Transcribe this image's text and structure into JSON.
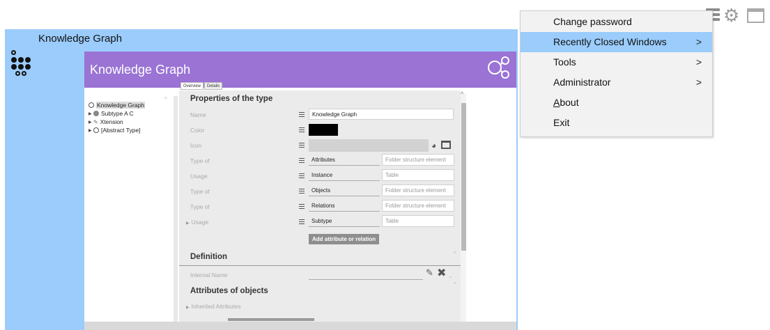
{
  "window": {
    "title": "Knowledge Graph"
  },
  "app": {
    "header_title": "Knowledge Graph",
    "tabs": [
      {
        "label": "Overview"
      },
      {
        "label": "Details"
      }
    ]
  },
  "tree": {
    "items": [
      {
        "label": "Knowledge Graph",
        "icon": "circle-outline-icon",
        "selected": true
      },
      {
        "label": "Subtype A C",
        "icon": "circle-filled-icon"
      },
      {
        "label": "Xtension",
        "icon": "pen-icon"
      },
      {
        "label": "[Abstract Type]",
        "icon": "circle-outline-icon"
      }
    ]
  },
  "properties": {
    "section_title": "Properties of the type",
    "name_label": "Name",
    "name_value": "Knowledge Graph",
    "color_label": "Color",
    "color_value": "#000000",
    "icon_label": "Icon",
    "rows": [
      {
        "label": "Type of",
        "value": "Attributes",
        "extra": "Folder structure element"
      },
      {
        "label": "Usage",
        "value": "Instance",
        "extra": "Table"
      },
      {
        "label": "Type of",
        "value": "Objects",
        "extra": "Folder structure element"
      },
      {
        "label": "Type of",
        "value": "Relations",
        "extra": "Folder structure element"
      },
      {
        "label": "Usage",
        "value": "Subtype",
        "extra": "Table"
      }
    ],
    "add_button": "Add attribute or relation"
  },
  "definition": {
    "section_title": "Definition",
    "internal_name_label": "Internal Name"
  },
  "attributes": {
    "section_title": "Attributes of objects",
    "inherited_label": "Inherited Attributes"
  },
  "menu": {
    "items": [
      {
        "label": "Change password",
        "submenu": false
      },
      {
        "label": "Recently Closed Windows",
        "submenu": true,
        "highlighted": true
      },
      {
        "label": "Tools",
        "submenu": true
      },
      {
        "label": "Administrator",
        "submenu": true
      },
      {
        "label": "About",
        "submenu": false
      },
      {
        "label": "Exit",
        "submenu": false
      }
    ],
    "submenu_arrow": ">"
  },
  "colors": {
    "outer_window": "#9bccfb",
    "header_purple": "#9a73d4",
    "menu_highlight": "#9bccfb"
  }
}
